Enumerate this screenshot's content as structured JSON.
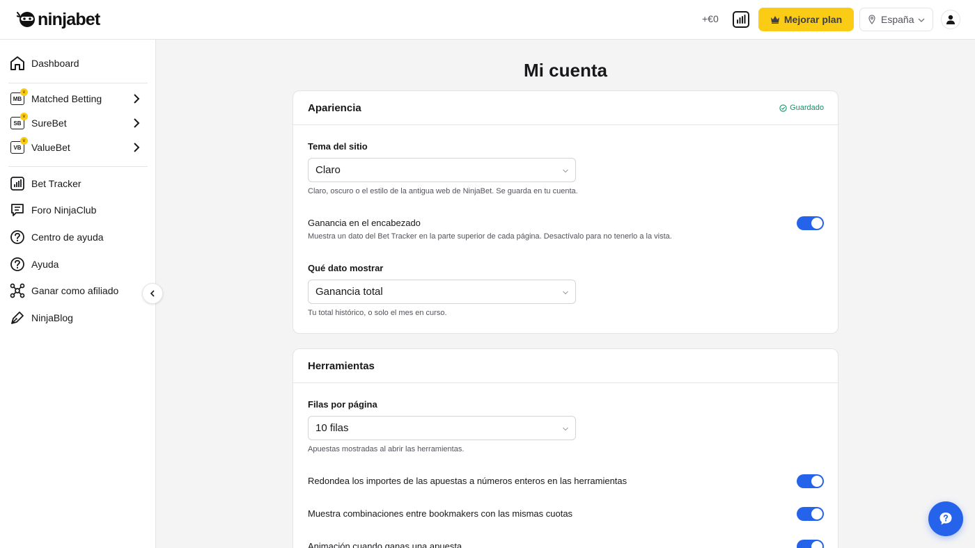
{
  "header": {
    "logo_text": "ninjabet",
    "profit": "+€0",
    "upgrade_label": "Mejorar plan",
    "country": "España"
  },
  "sidebar": {
    "items": [
      {
        "label": "Dashboard"
      },
      {
        "label": "Matched Betting",
        "badge": "MB"
      },
      {
        "label": "SureBet",
        "badge": "SB"
      },
      {
        "label": "ValueBet",
        "badge": "VB"
      },
      {
        "label": "Bet Tracker"
      },
      {
        "label": "Foro NinjaClub"
      },
      {
        "label": "Centro de ayuda"
      },
      {
        "label": "Ayuda"
      },
      {
        "label": "Ganar como afiliado"
      },
      {
        "label": "NinjaBlog"
      }
    ]
  },
  "main": {
    "title": "Mi cuenta",
    "appearance": {
      "title": "Apariencia",
      "saved": "Guardado",
      "theme_label": "Tema del sitio",
      "theme_value": "Claro",
      "theme_help": "Claro, oscuro o el estilo de la antigua web de NinjaBet. Se guarda en tu cuenta.",
      "header_profit_label": "Ganancia en el encabezado",
      "header_profit_help": "Muestra un dato del Bet Tracker en la parte superior de cada página. Desactívalo para no tenerlo a la vista.",
      "header_profit_on": true,
      "data_label": "Qué dato mostrar",
      "data_value": "Ganancia total",
      "data_help": "Tu total histórico, o solo el mes en curso."
    },
    "tools": {
      "title": "Herramientas",
      "rows_label": "Filas por página",
      "rows_value": "10 filas",
      "rows_help": "Apuestas mostradas al abrir las herramientas.",
      "toggles": [
        {
          "label": "Redondea los importes de las apuestas a números enteros en las herramientas",
          "on": true
        },
        {
          "label": "Muestra combinaciones entre bookmakers con las mismas cuotas",
          "on": true
        },
        {
          "label": "Animación cuando ganas una apuesta",
          "on": true
        }
      ]
    }
  },
  "colors": {
    "accent": "#2563eb",
    "upgrade": "#facc15",
    "saved": "#059669"
  }
}
